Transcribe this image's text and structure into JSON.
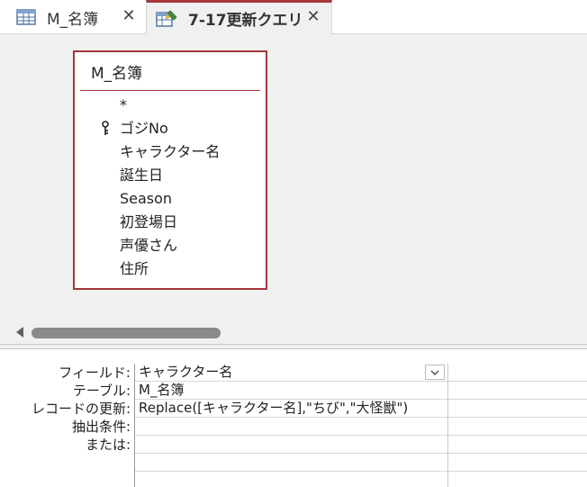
{
  "tabs": [
    {
      "label": "M_名簿",
      "icon": "table-icon",
      "close": "✕"
    },
    {
      "label": "7-17更新クエリ",
      "icon": "update-query-icon",
      "close": "✕",
      "active": true
    }
  ],
  "table_box": {
    "title": "M_名簿",
    "fields": [
      {
        "name": "*",
        "key": false
      },
      {
        "name": "ゴジNo",
        "key": true
      },
      {
        "name": "キャラクター名",
        "key": false
      },
      {
        "name": "誕生日",
        "key": false
      },
      {
        "name": "Season",
        "key": false
      },
      {
        "name": "初登場日",
        "key": false
      },
      {
        "name": "声優さん",
        "key": false
      },
      {
        "name": "住所",
        "key": false
      }
    ]
  },
  "grid": {
    "row_labels": [
      "フィールド:",
      "テーブル:",
      "レコードの更新:",
      "抽出条件:",
      "または:"
    ],
    "column1": {
      "field": "キャラクター名",
      "table": "M_名簿",
      "update_to": "Replace([キャラクター名],\"ちび\",\"大怪獣\")",
      "criteria": "",
      "or": ""
    }
  },
  "colors": {
    "accent": "#a4373a",
    "design_bg": "#f0f0f0"
  }
}
